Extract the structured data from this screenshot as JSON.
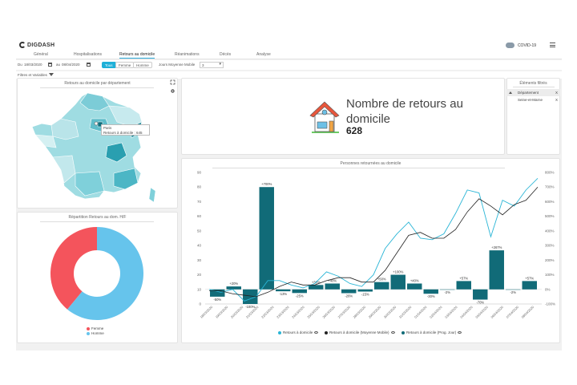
{
  "app": {
    "logo_text": "DIGDASH",
    "project_label": "COVID-19",
    "icons": {
      "logo": "digdash-logo-icon",
      "project": "virus-cloud-icon",
      "menu": "hamburger-menu-icon"
    }
  },
  "tabs": [
    {
      "label": "Général",
      "active": false
    },
    {
      "label": "Hospitalisations",
      "active": false
    },
    {
      "label": "Retours au domicile",
      "active": true
    },
    {
      "label": "Réanimations",
      "active": false
    },
    {
      "label": "Décès",
      "active": false
    },
    {
      "label": "Analyse",
      "active": false
    }
  ],
  "filters": {
    "from_label": "Du",
    "from_value": "18/03/2020",
    "to_label": "au",
    "to_value": "08/04/2020",
    "sex_options": [
      {
        "label": "Tous",
        "selected": true
      },
      {
        "label": "Femme",
        "selected": false
      },
      {
        "label": "Homme",
        "selected": false
      }
    ],
    "moving_avg_label": "Jours Moyenne Mobile",
    "moving_avg_value": "3",
    "filters_variables_label": "Filtres et Variables"
  },
  "map_panel": {
    "title": "Retours au domicile par département",
    "tooltip_line1": "Paris",
    "tooltip_line2": "Retours à domicile : 645",
    "icons": [
      "expand-icon",
      "settings-icon"
    ]
  },
  "kpi": {
    "title": "Nombre de retours au domicile",
    "value": "628",
    "icon": "house-icon"
  },
  "filtered_elements": {
    "title": "Éléments filtrés",
    "header": "Département",
    "items": [
      "Seine-et-Marne"
    ],
    "remove_glyph": "X"
  },
  "donut": {
    "title": "Répartition Retours au dom. H/F",
    "legend": [
      {
        "label": "Femme",
        "color": "#f4545c",
        "share": 0.39
      },
      {
        "label": "Homme",
        "color": "#66c4ec",
        "share": 0.61
      }
    ]
  },
  "chart_data": {
    "type": "bar",
    "title": "Personnes retournées au domicile",
    "categories": [
      "18/03/2020",
      "19/03/2020",
      "20/03/2020",
      "21/03/2020",
      "22/03/2020",
      "23/03/2020",
      "24/03/2020",
      "25/03/2020",
      "26/03/2020",
      "27/03/2020",
      "28/03/2020",
      "29/03/2020",
      "30/03/2020",
      "31/03/2020",
      "01/04/2020",
      "02/04/2020",
      "03/04/2020",
      "04/04/2020",
      "05/04/2020",
      "06/04/2020",
      "07/04/2020",
      "08/04/2020"
    ],
    "left_ylim": [
      0,
      90
    ],
    "left_yticks": [
      0,
      10,
      20,
      30,
      40,
      50,
      60,
      70,
      80,
      90
    ],
    "right_ylim": [
      -100,
      800
    ],
    "right_yticks": [
      "-100%",
      "0%",
      "100%",
      "200%",
      "300%",
      "400%",
      "500%",
      "600%",
      "700%",
      "800%"
    ],
    "series": [
      {
        "name": "Retours à domicile",
        "kind": "line",
        "axis": "left",
        "color": "#2ab5d6",
        "values": [
          10,
          8,
          10,
          2,
          5,
          16,
          16,
          13,
          11,
          14,
          22,
          19,
          14,
          12,
          20,
          38,
          48,
          56,
          45,
          44,
          48,
          62,
          78,
          76,
          46,
          71,
          67,
          78,
          86
        ]
      },
      {
        "name": "Retours à domicile (Moyenne Mobile)",
        "kind": "line",
        "axis": "left",
        "color": "#222222",
        "values": [
          9,
          9,
          7,
          6,
          5,
          8,
          12,
          15,
          13,
          13,
          16,
          18,
          18,
          15,
          15,
          23,
          35,
          47,
          49,
          45,
          45,
          51,
          63,
          72,
          67,
          61,
          68,
          71,
          80
        ]
      },
      {
        "name": "Retours à domicile (Prog. Jour)",
        "kind": "bar",
        "axis": "right",
        "color": "#116b78",
        "values": [
          -50,
          20,
          -100,
          700,
          -13,
          -25,
          30,
          40,
          -26,
          -15,
          50,
          100,
          40,
          -30,
          -2,
          57,
          -70,
          267,
          -2,
          57
        ],
        "labels": [
          "-50%",
          "+20%",
          "-100%",
          "+700%",
          "-13%",
          "-25%",
          "+30%",
          "+40%",
          "-26%",
          "-15%",
          "+50%",
          "+100%",
          "+40%",
          "-30%",
          "-2%",
          "+57%",
          "-70%",
          "+267%",
          "-2%",
          "+57%"
        ]
      }
    ],
    "legend_position": "bottom",
    "grid": false
  }
}
